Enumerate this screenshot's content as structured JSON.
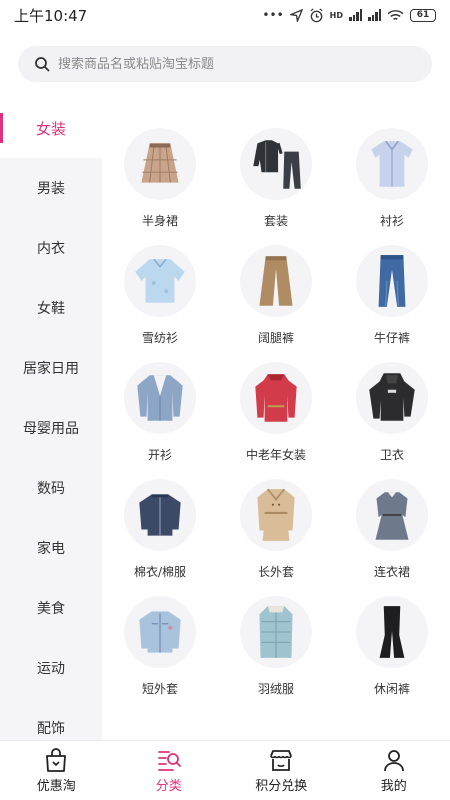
{
  "status_bar": {
    "time": "上午10:47",
    "network": "HD",
    "battery": "61"
  },
  "search": {
    "placeholder": "搜索商品名或粘贴淘宝标题"
  },
  "sidebar": {
    "items": [
      {
        "label": "女装",
        "active": true
      },
      {
        "label": "男装"
      },
      {
        "label": "内衣"
      },
      {
        "label": "女鞋"
      },
      {
        "label": "居家日用"
      },
      {
        "label": "母婴用品"
      },
      {
        "label": "数码"
      },
      {
        "label": "家电"
      },
      {
        "label": "美食"
      },
      {
        "label": "运动"
      },
      {
        "label": "配饰"
      }
    ]
  },
  "categories": [
    {
      "label": "半身裙",
      "icon": "skirt-icon",
      "color": "#c9a48a"
    },
    {
      "label": "套装",
      "icon": "tracksuit-icon",
      "color": "#2f3338"
    },
    {
      "label": "衬衫",
      "icon": "shirt-icon",
      "color": "#c7d2ec"
    },
    {
      "label": "雪纺衫",
      "icon": "chiffon-icon",
      "color": "#bcd8ee"
    },
    {
      "label": "阔腿裤",
      "icon": "wide-pants-icon",
      "color": "#b08c64"
    },
    {
      "label": "牛仔裤",
      "icon": "jeans-icon",
      "color": "#3f6aa3"
    },
    {
      "label": "开衫",
      "icon": "cardigan-icon",
      "color": "#8ea6c6"
    },
    {
      "label": "中老年女装",
      "icon": "coat-icon",
      "color": "#d23c4a"
    },
    {
      "label": "卫衣",
      "icon": "hoodie-icon",
      "color": "#2c2c2e"
    },
    {
      "label": "棉衣/棉服",
      "icon": "jacket-icon",
      "color": "#3c4a66"
    },
    {
      "label": "长外套",
      "icon": "trench-coat-icon",
      "color": "#d9bd98"
    },
    {
      "label": "连衣裙",
      "icon": "dress-icon",
      "color": "#6e7a8c"
    },
    {
      "label": "短外套",
      "icon": "denim-jacket-icon",
      "color": "#a9c3dc"
    },
    {
      "label": "羽绒服",
      "icon": "down-coat-icon",
      "color": "#9fc3cf"
    },
    {
      "label": "休闲裤",
      "icon": "flare-pants-icon",
      "color": "#1e1e20"
    }
  ],
  "bottom_nav": [
    {
      "label": "优惠淘",
      "icon": "bag-icon"
    },
    {
      "label": "分类",
      "icon": "category-search-icon",
      "active": true
    },
    {
      "label": "积分兑换",
      "icon": "store-icon"
    },
    {
      "label": "我的",
      "icon": "person-icon"
    }
  ],
  "colors": {
    "accent": "#e0327c",
    "sidebar_bg": "#f5f5f7"
  }
}
